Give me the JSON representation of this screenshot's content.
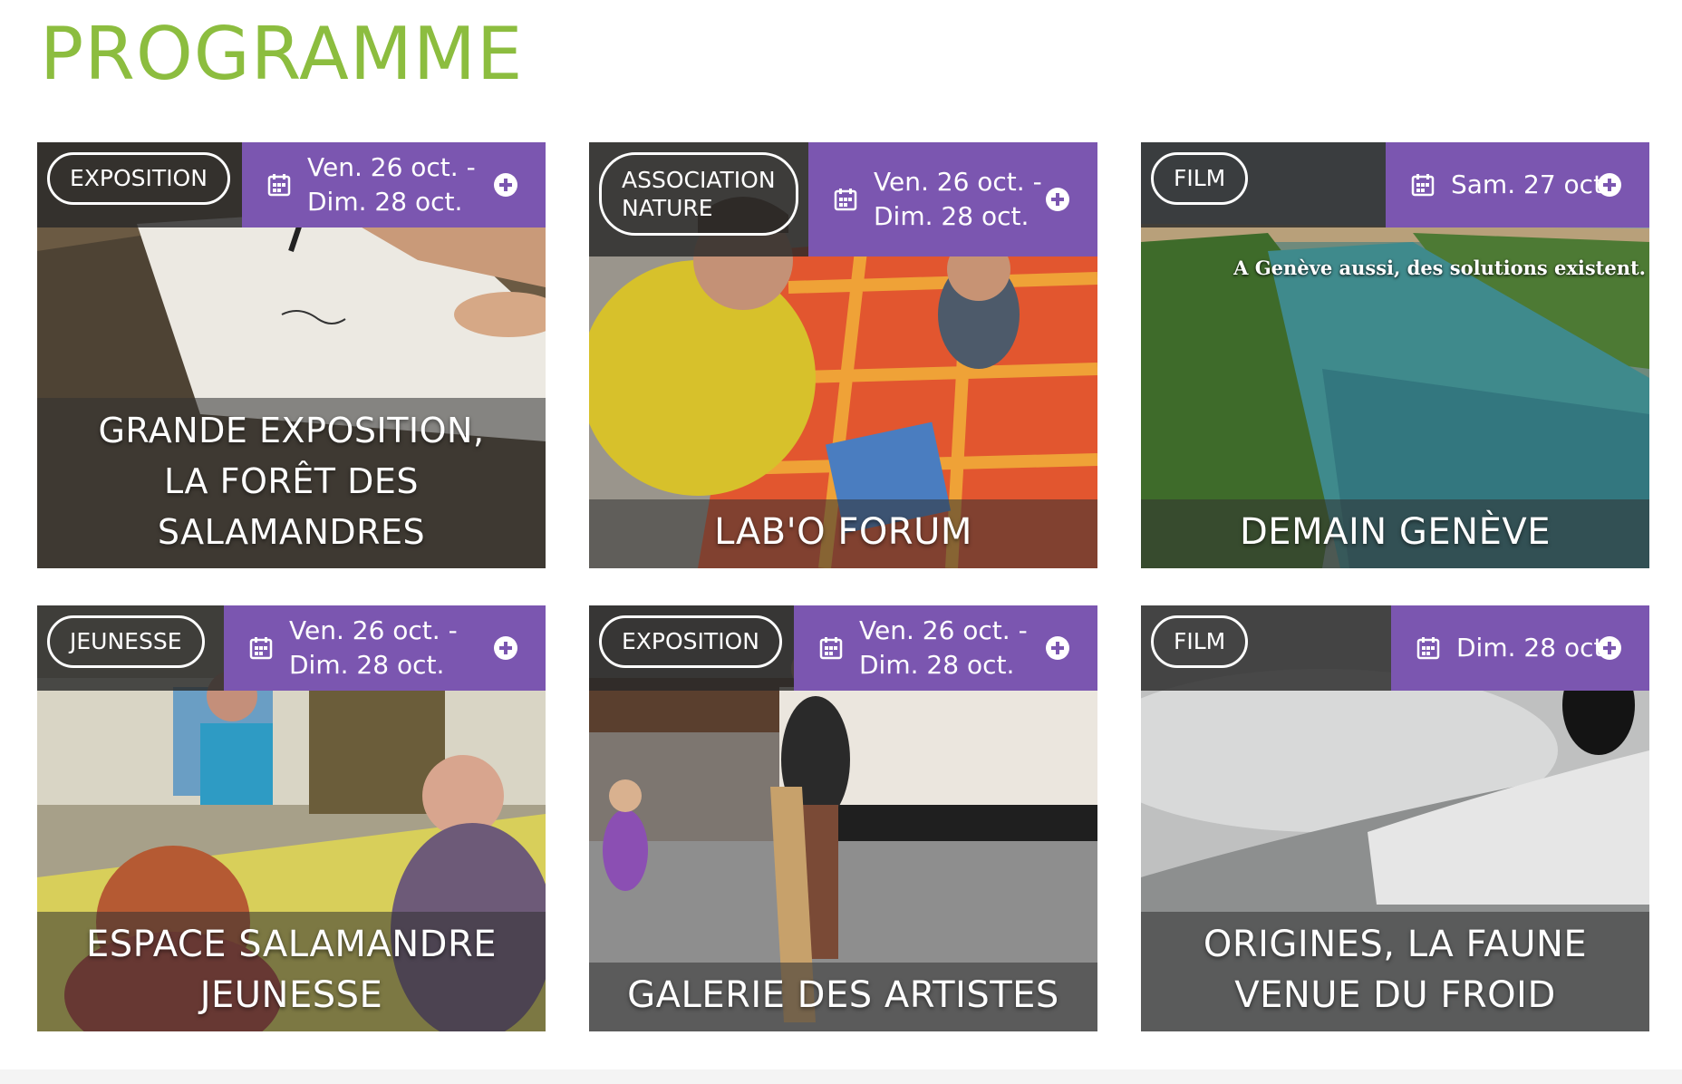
{
  "page": {
    "title": "PROGRAMME"
  },
  "colors": {
    "accent_green": "#8cbd3f",
    "date_purple": "#7b56b0"
  },
  "icons": {
    "date": "calendar-icon",
    "more": "plus-circle-icon"
  },
  "events": [
    {
      "category": "EXPOSITION",
      "date_line1": "Ven. 26 oct. -",
      "date_line2": "Dim. 28 oct.",
      "title_lines": [
        "GRANDE EXPOSITION,",
        "LA FORÊT DES",
        "SALAMANDRES"
      ]
    },
    {
      "category_lines": [
        "ASSOCIATION",
        "NATURE"
      ],
      "date_line1": "Ven. 26 oct. -",
      "date_line2": "Dim. 28 oct.",
      "title": "LAB'O FORUM"
    },
    {
      "category": "FILM",
      "date": "Sam. 27 oct.",
      "title": "DEMAIN GENÈVE",
      "image_caption": "A Genève aussi, des solutions existent."
    },
    {
      "category": "JEUNESSE",
      "date_line1": "Ven. 26 oct. -",
      "date_line2": "Dim. 28 oct.",
      "title_lines": [
        "ESPACE SALAMANDRE",
        "JEUNESSE"
      ]
    },
    {
      "category": "EXPOSITION",
      "date_line1": "Ven. 26 oct. -",
      "date_line2": "Dim. 28 oct.",
      "title": "GALERIE DES ARTISTES"
    },
    {
      "category": "FILM",
      "date": "Dim. 28 oct.",
      "title_lines": [
        "ORIGINES, LA FAUNE",
        "VENUE DU FROID"
      ]
    }
  ]
}
